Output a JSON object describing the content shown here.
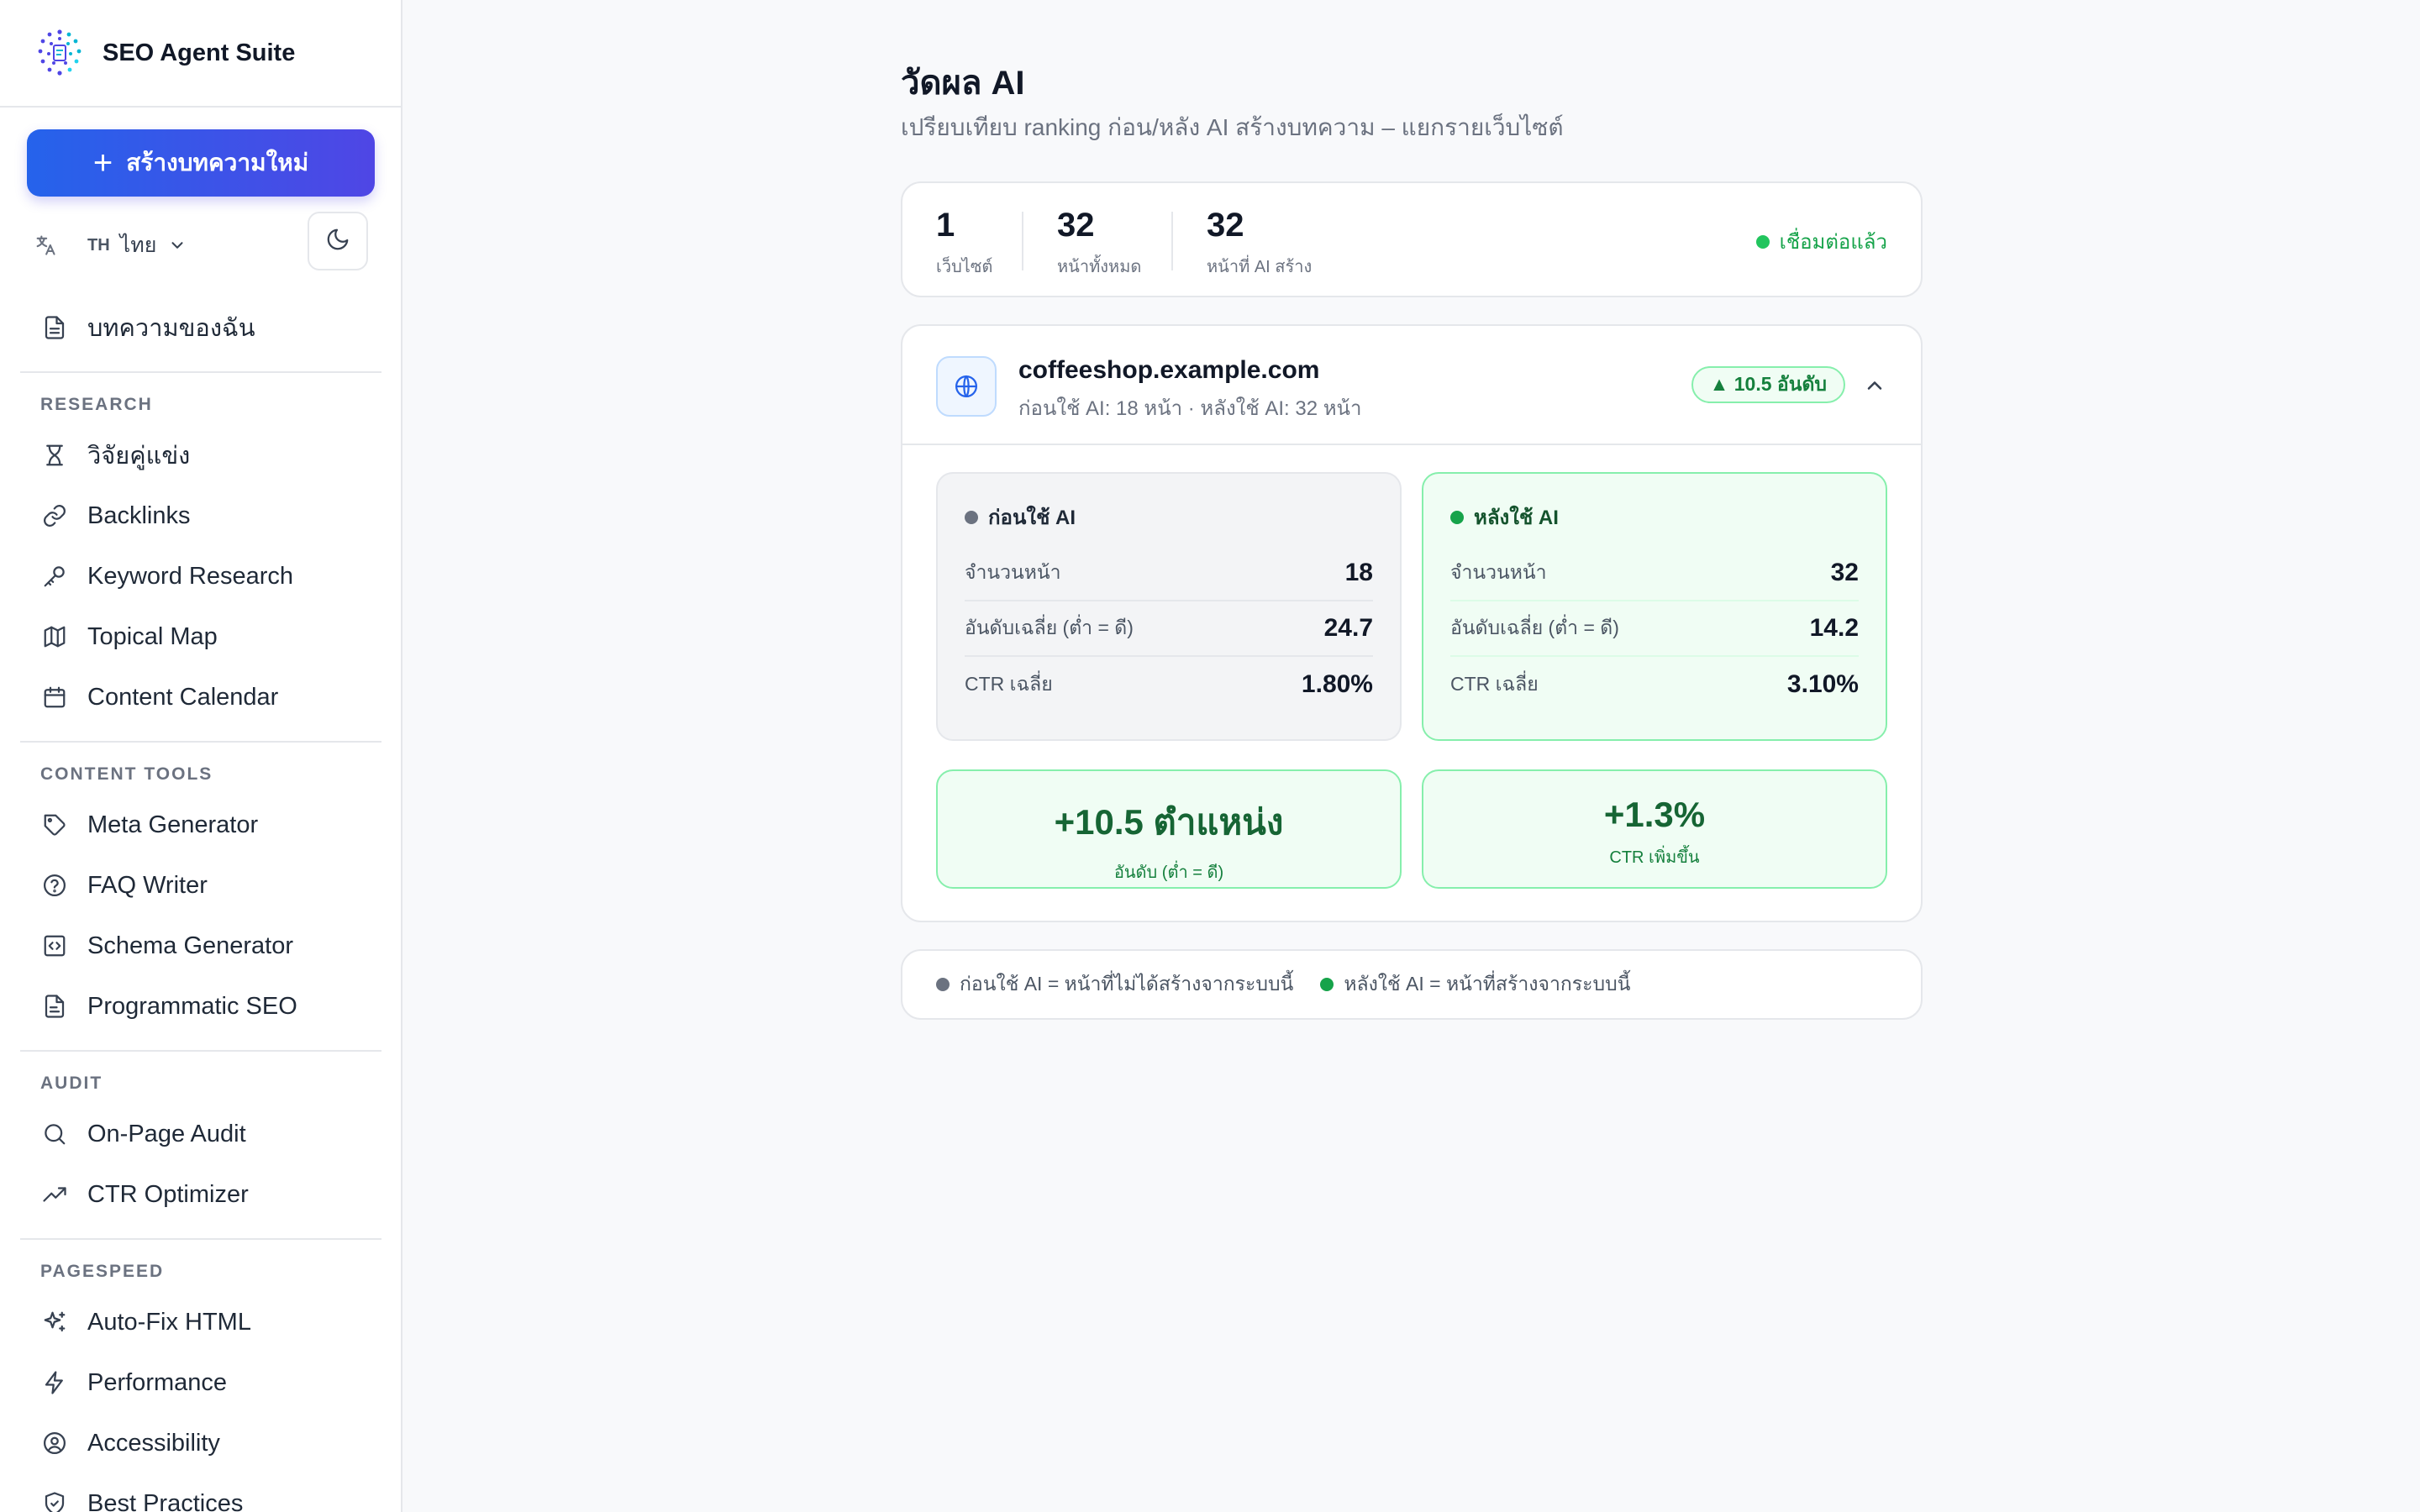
{
  "app": {
    "name": "SEO Agent Suite"
  },
  "sidebar": {
    "new_article_label": "สร้างบทความใหม่",
    "language": {
      "code": "TH",
      "label": "ไทย"
    },
    "top_items": [
      {
        "label": "บทความของฉัน",
        "icon": "document-icon"
      }
    ],
    "sections": [
      {
        "title": "RESEARCH",
        "items": [
          {
            "label": "วิจัยคู่แข่ง",
            "icon": "trophy-icon"
          },
          {
            "label": "Backlinks",
            "icon": "link-icon"
          },
          {
            "label": "Keyword Research",
            "icon": "key-icon"
          },
          {
            "label": "Topical Map",
            "icon": "map-icon"
          },
          {
            "label": "Content Calendar",
            "icon": "calendar-icon"
          }
        ]
      },
      {
        "title": "CONTENT TOOLS",
        "items": [
          {
            "label": "Meta Generator",
            "icon": "tag-icon"
          },
          {
            "label": "FAQ Writer",
            "icon": "help-circle-icon"
          },
          {
            "label": "Schema Generator",
            "icon": "code-icon"
          },
          {
            "label": "Programmatic SEO",
            "icon": "file-text-icon"
          }
        ]
      },
      {
        "title": "AUDIT",
        "items": [
          {
            "label": "On-Page Audit",
            "icon": "search-icon"
          },
          {
            "label": "CTR Optimizer",
            "icon": "trending-up-icon"
          }
        ]
      },
      {
        "title": "PAGESPEED",
        "items": [
          {
            "label": "Auto-Fix HTML",
            "icon": "sparkles-icon"
          },
          {
            "label": "Performance",
            "icon": "lightning-icon"
          },
          {
            "label": "Accessibility",
            "icon": "user-circle-icon"
          },
          {
            "label": "Best Practices",
            "icon": "shield-check-icon"
          }
        ]
      }
    ]
  },
  "page": {
    "title": "วัดผล AI",
    "subtitle": "เปรียบเทียบ ranking ก่อน/หลัง AI สร้างบทความ – แยกรายเว็บไซต์"
  },
  "stats": {
    "items": [
      {
        "value": "1",
        "label": "เว็บไซต์"
      },
      {
        "value": "32",
        "label": "หน้าทั้งหมด"
      },
      {
        "value": "32",
        "label": "หน้าที่ AI สร้าง"
      }
    ],
    "status": "เชื่อมต่อแล้ว"
  },
  "site": {
    "domain": "coffeeshop.example.com",
    "meta": "ก่อนใช้ AI: 18 หน้า · หลังใช้ AI: 32 หน้า",
    "badge": "▲ 10.5 อันดับ",
    "before": {
      "title": "ก่อนใช้ AI",
      "rows": [
        {
          "label": "จำนวนหน้า",
          "value": "18"
        },
        {
          "label": "อันดับเฉลี่ย (ต่ำ = ดี)",
          "value": "24.7"
        },
        {
          "label": "CTR เฉลี่ย",
          "value": "1.80%"
        }
      ]
    },
    "after": {
      "title": "หลังใช้ AI",
      "rows": [
        {
          "label": "จำนวนหน้า",
          "value": "32"
        },
        {
          "label": "อันดับเฉลี่ย (ต่ำ = ดี)",
          "value": "14.2"
        },
        {
          "label": "CTR เฉลี่ย",
          "value": "3.10%"
        }
      ]
    },
    "deltas": [
      {
        "value": "+10.5 ตำแหน่ง",
        "label": "อันดับ (ต่ำ = ดี)"
      },
      {
        "value": "+1.3%",
        "label": "CTR เพิ่มขึ้น"
      }
    ]
  },
  "legend": [
    "ก่อนใช้ AI = หน้าที่ไม่ได้สร้างจากระบบนี้",
    "หลังใช้ AI = หน้าที่สร้างจากระบบนี้"
  ],
  "colors": {
    "accent": "#4f46e5",
    "success": "#16a34a",
    "before_dot": "#6b7280",
    "after_dot": "#16a34a"
  }
}
